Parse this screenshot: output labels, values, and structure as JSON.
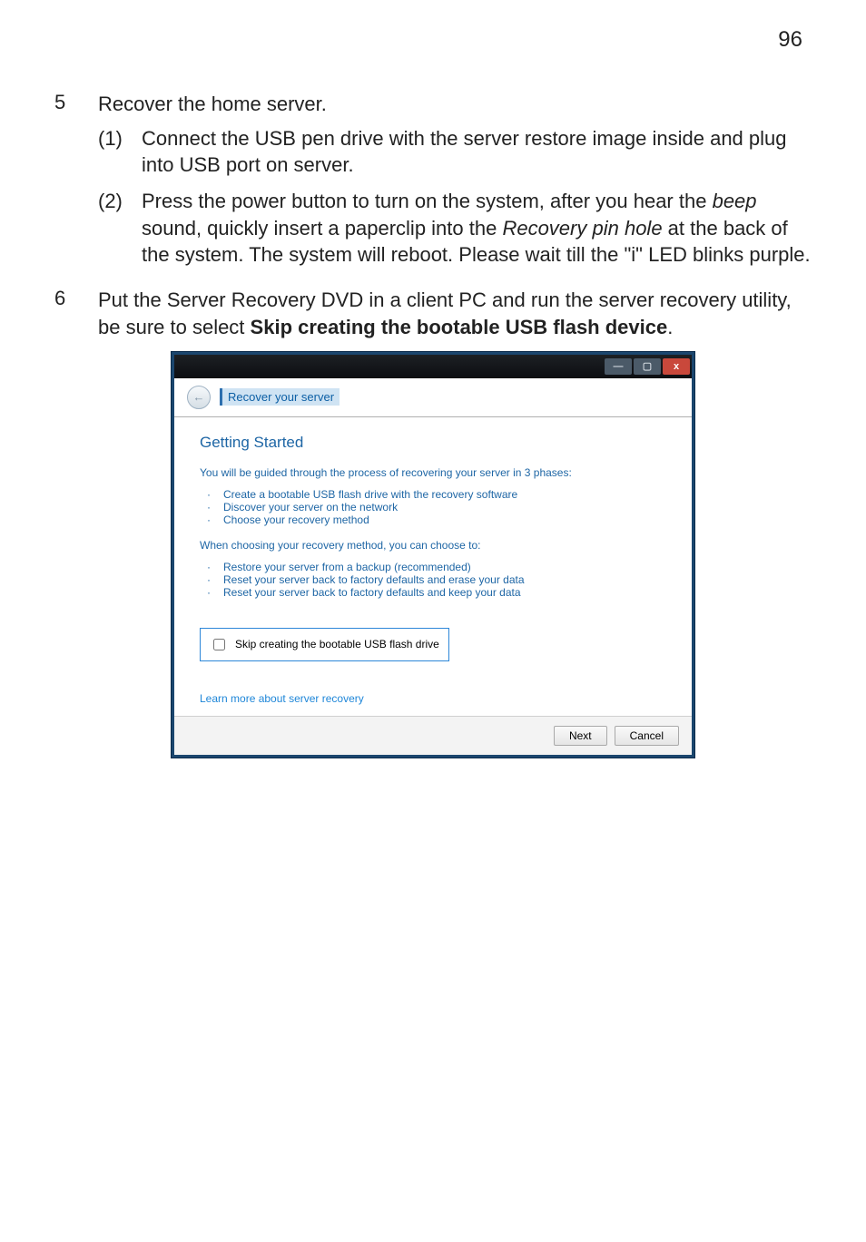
{
  "page_number": "96",
  "steps": [
    {
      "num": "5",
      "lead": "Recover the home server.",
      "subs": [
        {
          "num": "(1)",
          "parts": [
            {
              "t": "Connect the USB pen drive with the server restore image inside and plug into USB port on server."
            }
          ]
        },
        {
          "num": "(2)",
          "parts": [
            {
              "t": "Press the power button to turn on the system, after you hear the "
            },
            {
              "t": "beep",
              "italic": true
            },
            {
              "t": " sound, quickly insert a paperclip into the "
            },
            {
              "t": "Recovery pin hole",
              "italic": true
            },
            {
              "t": " at the back of the system. The system will reboot. Please wait till the \"i\" LED blinks purple."
            }
          ]
        }
      ]
    },
    {
      "num": "6",
      "lead_parts": [
        {
          "t": "Put the Server Recovery DVD in a client PC and run the server recovery utility, be sure to select "
        },
        {
          "t": "Skip creating the bootable USB flash device",
          "bold": true
        },
        {
          "t": "."
        }
      ]
    }
  ],
  "wizard": {
    "window_controls": {
      "min": "—",
      "max": "▢",
      "close": "x"
    },
    "header_title": "Recover your server",
    "section_title": "Getting Started",
    "phases_intro": "You will be guided through the process of recovering your server in 3 phases:",
    "phases": [
      "Create a bootable USB flash drive with the recovery software",
      "Discover your server on the network",
      "Choose your recovery method"
    ],
    "choices_intro": "When choosing your recovery method, you can choose to:",
    "choices": [
      "Restore your server from a backup (recommended)",
      "Reset your server back to factory defaults and erase your data",
      "Reset your server back to factory defaults and keep your data"
    ],
    "skip_label": "Skip creating the bootable USB flash drive",
    "learn_more": "Learn more about server recovery",
    "buttons": {
      "next": "Next",
      "cancel": "Cancel"
    }
  }
}
